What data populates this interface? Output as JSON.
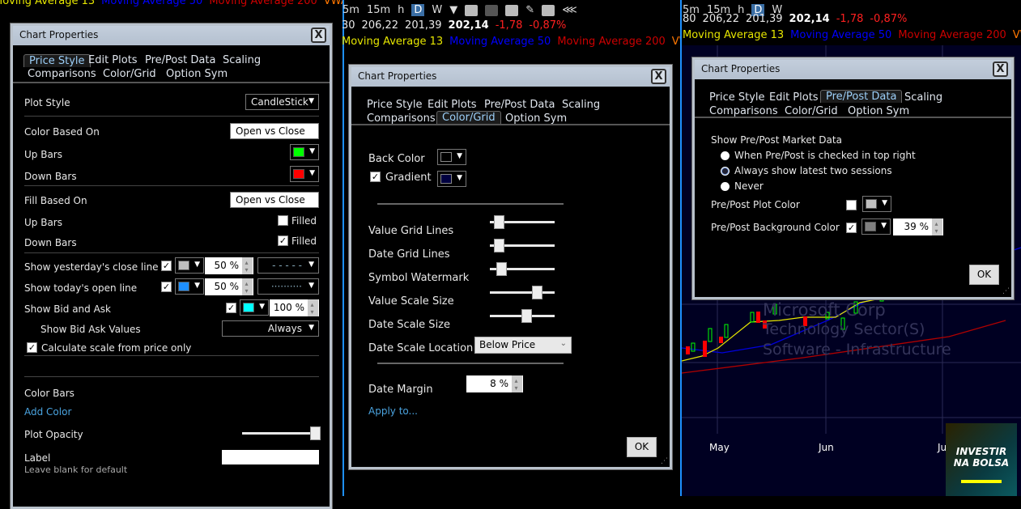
{
  "toolbar": {
    "tf": [
      "5m",
      "15m",
      "h",
      "D",
      "W"
    ],
    "selected": "D"
  },
  "quote": {
    "prefix_mid": "30",
    "prefix_right": "80",
    "high": "206,22",
    "low": "201,39",
    "last": "202,14",
    "change": "-1,78",
    "change_pct": "-0,87%"
  },
  "studies": [
    {
      "label": "Moving Average 13",
      "color": "#e6e600"
    },
    {
      "label": "Moving Average 50",
      "color": "#0000ff"
    },
    {
      "label": "Moving Average 200",
      "color": "#cc0000"
    },
    {
      "label": "VWAP",
      "color": "#ff7700"
    }
  ],
  "watermark": {
    "name": "Microsoft Corp",
    "sector": "Technology Sector(S)",
    "industry": "Software - Infrastructure"
  },
  "date_axis": [
    "May",
    "Jun",
    "Ju"
  ],
  "logo": {
    "line1": "INVESTIR",
    "line2": "NA BOLSA"
  },
  "tabs": [
    "Price Style",
    "Edit Plots",
    "Pre/Post Data",
    "Scaling",
    "Comparisons",
    "Color/Grid",
    "Option Sym"
  ],
  "dialog_title": "Chart Properties",
  "close": "X",
  "ok": "OK",
  "price_style": {
    "plot_style_label": "Plot Style",
    "plot_style": "CandleStick",
    "color_based_on_label": "Color Based On",
    "color_based_on": "Open vs Close",
    "up_bars": "Up Bars",
    "up_color": "#00ff00",
    "down_bars": "Down Bars",
    "down_color": "#ff0000",
    "fill_based_on_label": "Fill Based On",
    "fill_based_on": "Open vs Close",
    "filled": "Filled",
    "up_filled": false,
    "down_filled": true,
    "yesterday_label": "Show yesterday's close line",
    "yesterday_pct": "50 %",
    "yesterday_color": "#c0c0c0",
    "open_label": "Show today's open line",
    "open_pct": "50 %",
    "open_color": "#1e90ff",
    "bidask_label": "Show Bid and Ask",
    "bidask_pct": "100 %",
    "bidask_color": "#00ffff",
    "bidask_values_label": "Show Bid Ask Values",
    "bidask_values": "Always",
    "calc_scale": "Calculate scale from price only",
    "color_bars": "Color Bars",
    "add_color": "Add Color",
    "plot_opacity": "Plot Opacity",
    "opacity_value": 100,
    "label_label": "Label",
    "label_value": "",
    "label_hint": "Leave blank for default"
  },
  "color_grid": {
    "back_color": "Back Color",
    "back_color_value": "#000000",
    "gradient": "Gradient",
    "gradient_checked": true,
    "gradient_color": "#000040",
    "sliders": [
      {
        "label": "Value Grid Lines",
        "value": 0.1
      },
      {
        "label": "Date Grid Lines",
        "value": 0.1
      },
      {
        "label": "Symbol Watermark",
        "value": 0.15
      },
      {
        "label": "Value Scale Size",
        "value": 0.72
      },
      {
        "label": "Date Scale Size",
        "value": 0.55
      }
    ],
    "date_scale_location_label": "Date Scale Location",
    "date_scale_location": "Below Price",
    "date_margin_label": "Date Margin",
    "date_margin": "8 %",
    "apply_to": "Apply to..."
  },
  "prepost": {
    "show_label": "Show Pre/Post Market Data",
    "options": [
      "When Pre/Post is checked in top right",
      "Always show latest two sessions",
      "Never"
    ],
    "selected": 1,
    "plot_color_label": "Pre/Post Plot Color",
    "plot_color": "#c0c0c0",
    "plot_checked": false,
    "bg_color_label": "Pre/Post Background Color",
    "bg_color": "#808080",
    "bg_checked": true,
    "bg_pct": "39 %"
  }
}
